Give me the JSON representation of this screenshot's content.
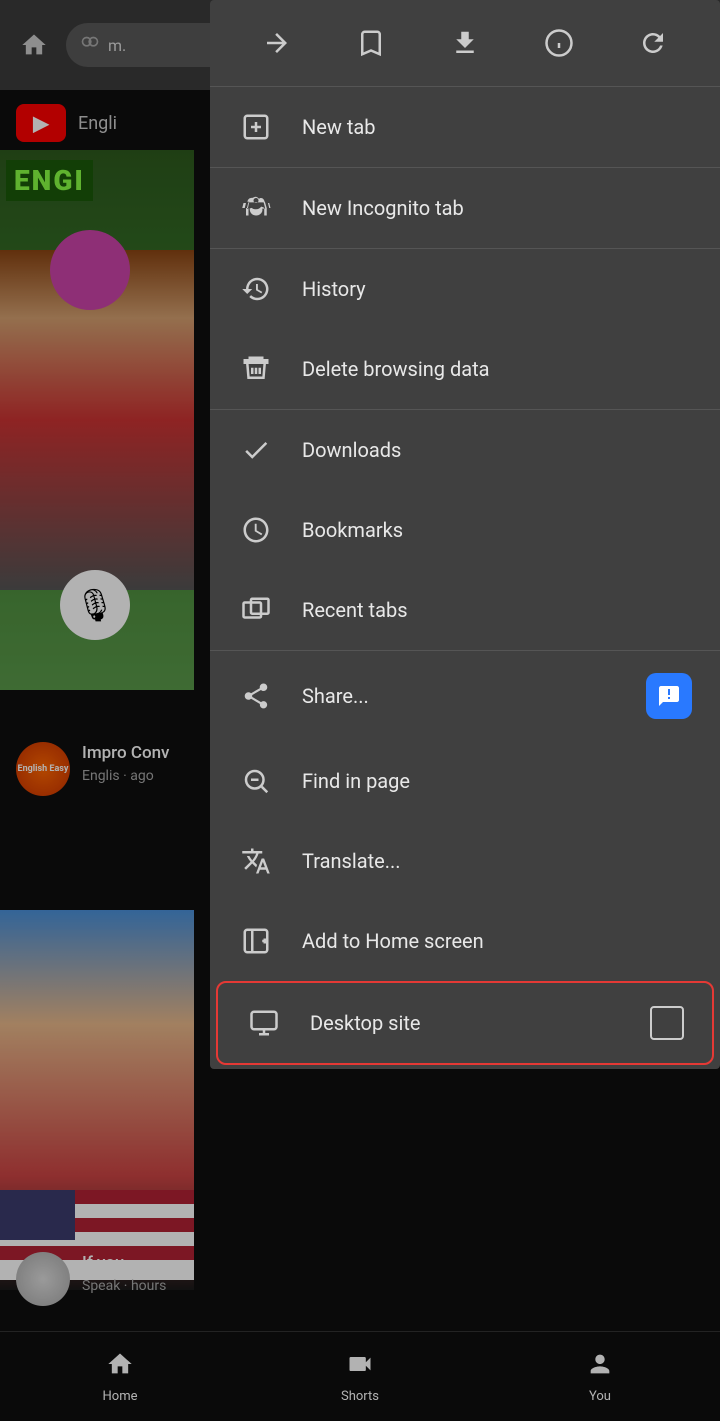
{
  "browser": {
    "home_icon": "⌂",
    "url_text": "m.",
    "privacy_icon": "⊙",
    "forward_icon": "→",
    "bookmark_icon": "☆",
    "download_icon": "⬇",
    "info_icon": "ℹ",
    "refresh_icon": "↺"
  },
  "youtube": {
    "logo_text": "▶",
    "header_text": "Engli",
    "engi_label": "ENGI",
    "mic_icon": "🎙",
    "video1_title": "Impro Conv",
    "video1_channel": "Englis",
    "video1_time": "ago",
    "video2_title": "If you",
    "video2_channel": "Speak",
    "video2_time": "hours"
  },
  "dropdown": {
    "toolbar": {
      "forward_label": "→",
      "bookmark_label": "☆",
      "download_label": "⬇",
      "info_label": "ⓘ",
      "refresh_label": "↺"
    },
    "items": [
      {
        "id": "new-tab",
        "label": "New tab",
        "icon": "new-tab-icon"
      },
      {
        "id": "new-incognito-tab",
        "label": "New Incognito tab",
        "icon": "incognito-icon"
      },
      {
        "id": "history",
        "label": "History",
        "icon": "history-icon"
      },
      {
        "id": "delete-browsing-data",
        "label": "Delete browsing data",
        "icon": "delete-icon"
      },
      {
        "id": "downloads",
        "label": "Downloads",
        "icon": "downloads-icon"
      },
      {
        "id": "bookmarks",
        "label": "Bookmarks",
        "icon": "bookmarks-icon"
      },
      {
        "id": "recent-tabs",
        "label": "Recent tabs",
        "icon": "recent-tabs-icon"
      },
      {
        "id": "share",
        "label": "Share...",
        "icon": "share-icon",
        "badge": true
      },
      {
        "id": "find-in-page",
        "label": "Find in page",
        "icon": "find-icon"
      },
      {
        "id": "translate",
        "label": "Translate...",
        "icon": "translate-icon"
      },
      {
        "id": "add-to-home-screen",
        "label": "Add to Home screen",
        "icon": "add-home-icon"
      },
      {
        "id": "desktop-site",
        "label": "Desktop site",
        "icon": "desktop-icon",
        "checkbox": true,
        "highlighted": true
      }
    ]
  },
  "bottom_nav": {
    "items": [
      {
        "id": "home",
        "icon": "⌂",
        "label": "Home"
      },
      {
        "id": "shorts",
        "icon": "▷",
        "label": "Shorts"
      },
      {
        "id": "you",
        "icon": "◯",
        "label": "You"
      }
    ]
  }
}
